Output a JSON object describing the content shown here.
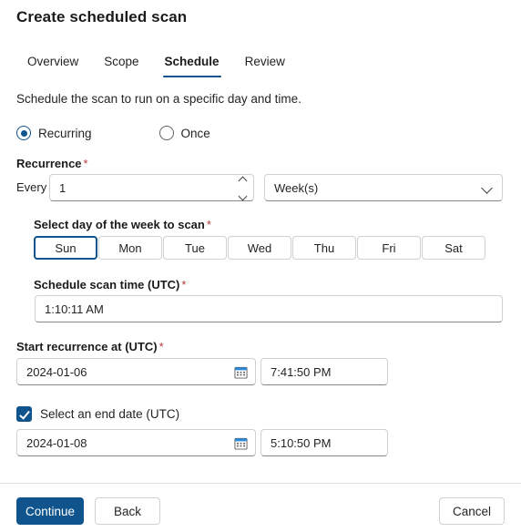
{
  "page_title": "Create scheduled scan",
  "tabs": [
    {
      "label": "Overview",
      "active": false
    },
    {
      "label": "Scope",
      "active": false
    },
    {
      "label": "Schedule",
      "active": true
    },
    {
      "label": "Review",
      "active": false
    }
  ],
  "description": "Schedule the scan to run on a specific day and time.",
  "schedule_type": {
    "options": [
      {
        "label": "Recurring",
        "checked": true
      },
      {
        "label": "Once",
        "checked": false
      }
    ]
  },
  "recurrence": {
    "label": "Recurrence",
    "required_marker": "*",
    "every_label": "Every",
    "interval_value": "1",
    "unit_value": "Week(s)",
    "spinner_up_icon": "chevron-up-icon",
    "spinner_down_icon": "chevron-down-icon",
    "dropdown_icon": "chevron-down-icon"
  },
  "day_of_week": {
    "label": "Select day of the week to scan",
    "required_marker": "*",
    "days": [
      {
        "label": "Sun",
        "selected": true
      },
      {
        "label": "Mon",
        "selected": false
      },
      {
        "label": "Tue",
        "selected": false
      },
      {
        "label": "Wed",
        "selected": false
      },
      {
        "label": "Thu",
        "selected": false
      },
      {
        "label": "Fri",
        "selected": false
      },
      {
        "label": "Sat",
        "selected": false
      }
    ]
  },
  "scan_time": {
    "label": "Schedule scan time (UTC)",
    "required_marker": "*",
    "value": "1:10:11 AM"
  },
  "start_recurrence": {
    "label": "Start recurrence at (UTC)",
    "required_marker": "*",
    "date_value": "2024-01-06",
    "time_value": "7:41:50 PM",
    "calendar_icon": "calendar-icon"
  },
  "end_date": {
    "checkbox_label": "Select an end date (UTC)",
    "checked": true,
    "date_value": "2024-01-08",
    "time_value": "5:10:50 PM",
    "calendar_icon": "calendar-icon"
  },
  "footer": {
    "continue_label": "Continue",
    "back_label": "Back",
    "cancel_label": "Cancel"
  },
  "colors": {
    "accent": "#0f548c",
    "required": "#b33a3a",
    "border": "#d1d1d1",
    "text": "#242424"
  }
}
